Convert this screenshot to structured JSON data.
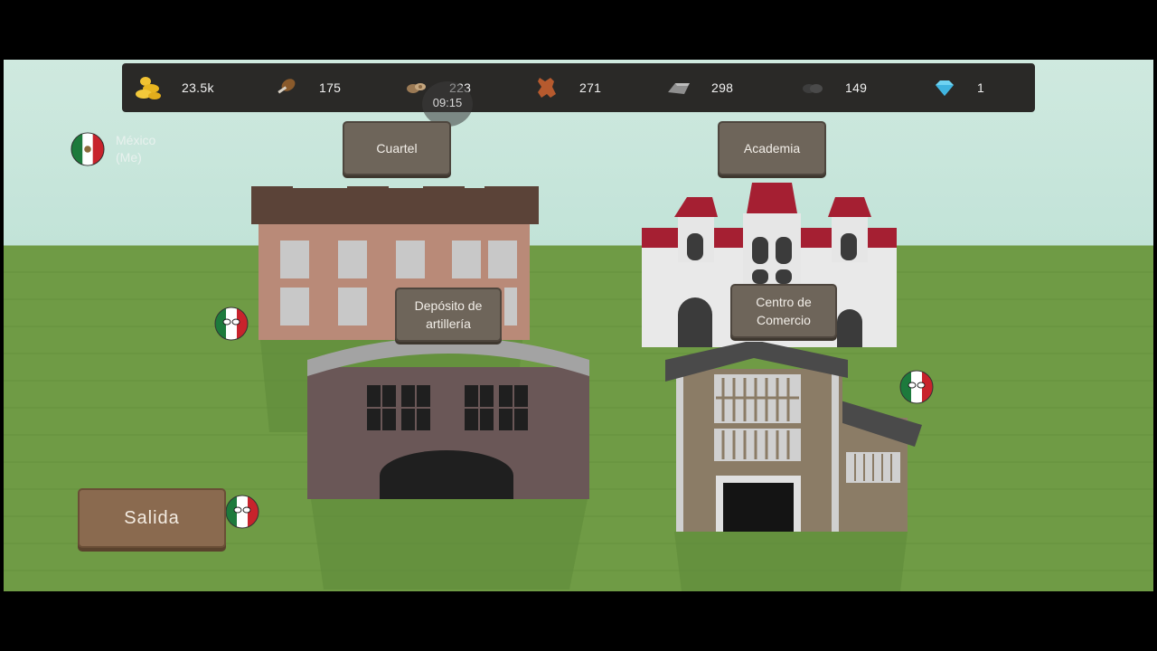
{
  "resources": [
    {
      "icon": "gold-coins-icon",
      "value": "23.5k"
    },
    {
      "icon": "drumstick-food-icon",
      "value": "175"
    },
    {
      "icon": "wood-logs-icon",
      "value": "223"
    },
    {
      "icon": "leather-hide-icon",
      "value": "271"
    },
    {
      "icon": "iron-ingot-icon",
      "value": "298"
    },
    {
      "icon": "coal-icon",
      "value": "149"
    },
    {
      "icon": "diamond-icon",
      "value": "1"
    }
  ],
  "clock": "09:15",
  "player": {
    "name": "México\n(Me)",
    "flag_colors": [
      "#1d7a3c",
      "#ffffff",
      "#c8232c"
    ]
  },
  "buildings": {
    "barracks": "Cuartel",
    "academy": "Academia",
    "artillery_depot": "Depósito de\nartillería",
    "trade_center": "Centro de\nComercio"
  },
  "exit_label": "Salida",
  "colors": {
    "sky": "#c2e3d8",
    "grass": "#6f9c45",
    "topbar": "#2a2927",
    "button": "#6e655a",
    "exit_button": "#8a6a4f"
  }
}
